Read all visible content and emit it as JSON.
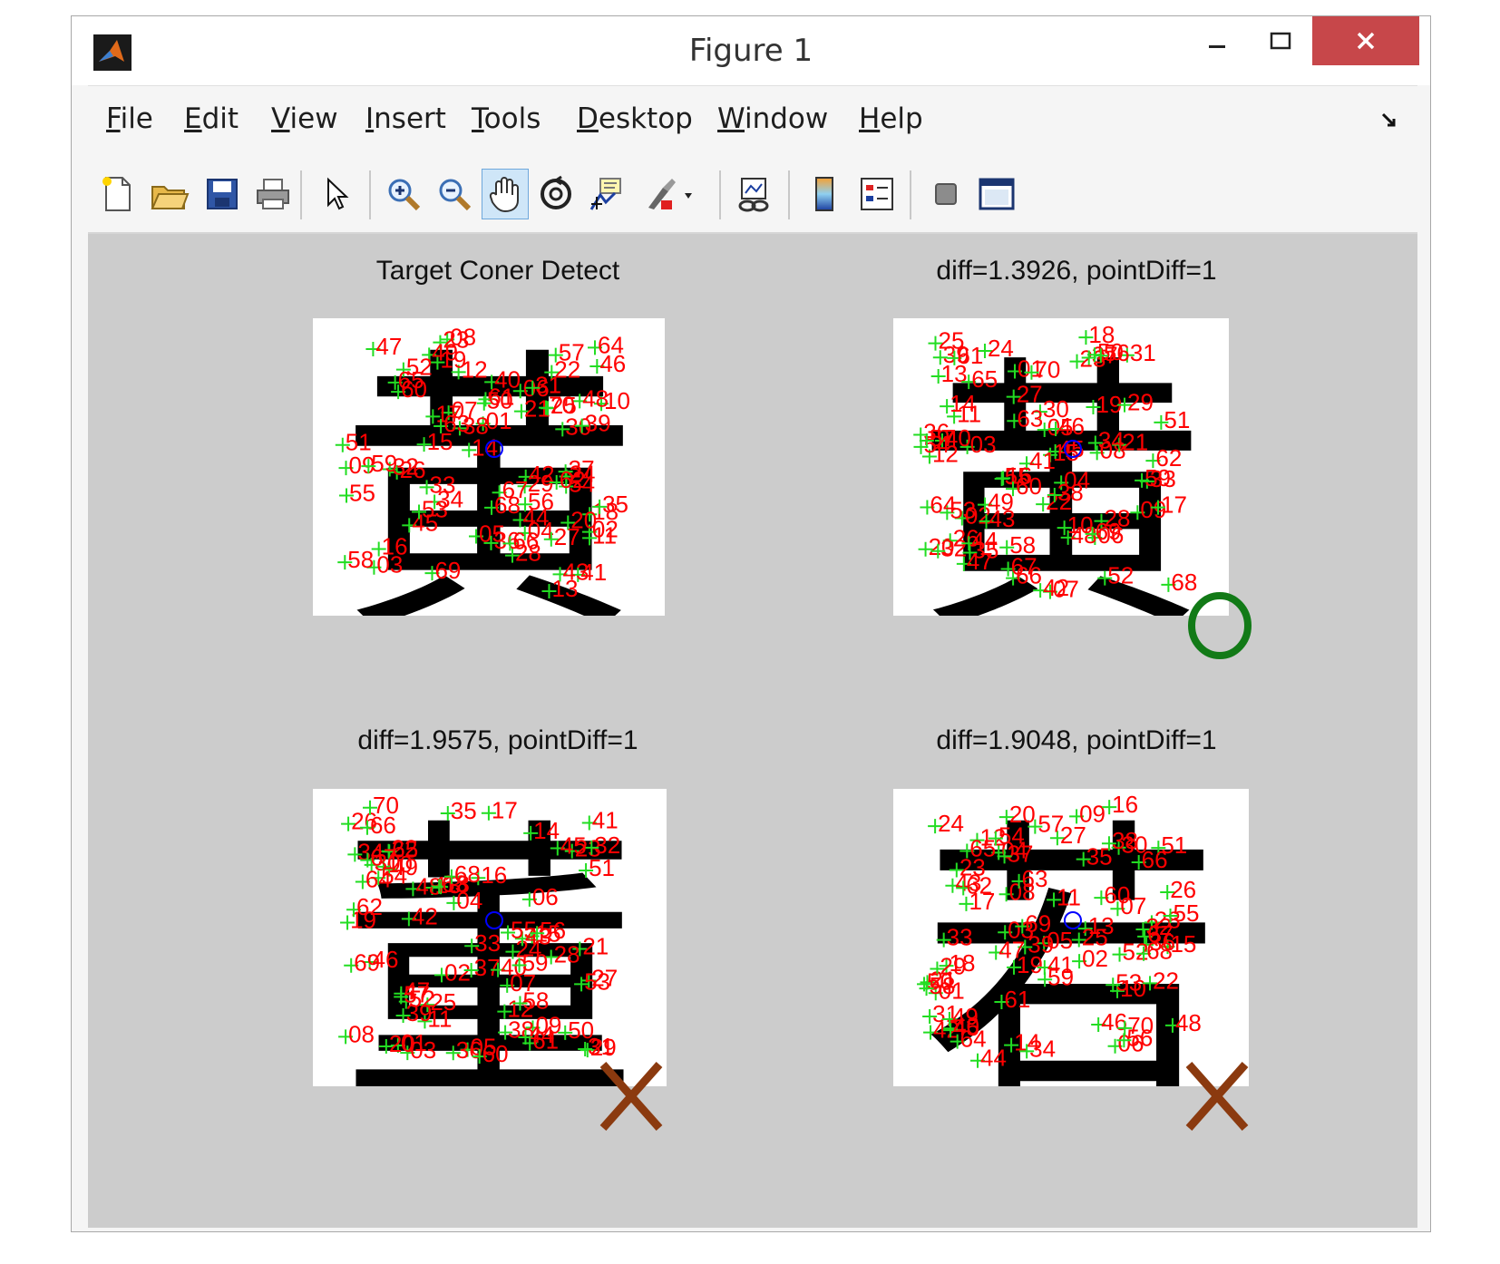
{
  "window": {
    "title": "Figure 1"
  },
  "menu": [
    {
      "ul": "F",
      "rest": "ile"
    },
    {
      "ul": "E",
      "rest": "dit"
    },
    {
      "ul": "V",
      "rest": "iew"
    },
    {
      "ul": "I",
      "rest": "nsert"
    },
    {
      "ul": "T",
      "rest": "ools"
    },
    {
      "ul": "D",
      "rest": "esktop"
    },
    {
      "ul": "W",
      "rest": "indow"
    },
    {
      "ul": "H",
      "rest": "elp"
    }
  ],
  "toolbar": [
    "new-figure-icon",
    "open-file-icon",
    "save-icon",
    "print-icon",
    "edit-plot-pointer-icon",
    "zoom-in-icon",
    "zoom-out-icon",
    "pan-hand-icon",
    "rotate-3d-icon",
    "data-cursor-icon",
    "brush-icon",
    "link-plot-icon",
    "colorbar-icon",
    "legend-icon",
    "hide-plot-tools-icon",
    "show-plot-tools-icon"
  ],
  "subplots": [
    {
      "title": "Target Coner Detect",
      "character": "黄",
      "verdict": ""
    },
    {
      "title": "diff=1.3926, pointDiff=1",
      "character": "黄",
      "verdict": "match"
    },
    {
      "title": "diff=1.9575, pointDiff=1",
      "character": "董",
      "verdict": "mismatch"
    },
    {
      "title": "diff=1.9048, pointDiff=1",
      "character": "若",
      "verdict": "mismatch"
    }
  ],
  "colors": {
    "corner_marker": "#22dd22",
    "corner_label": "#ff0000",
    "center_marker": "#0000ff",
    "match_circle": "#127a17",
    "mismatch_x": "#8b3a0f",
    "canvas_bg": "#cccccc"
  }
}
